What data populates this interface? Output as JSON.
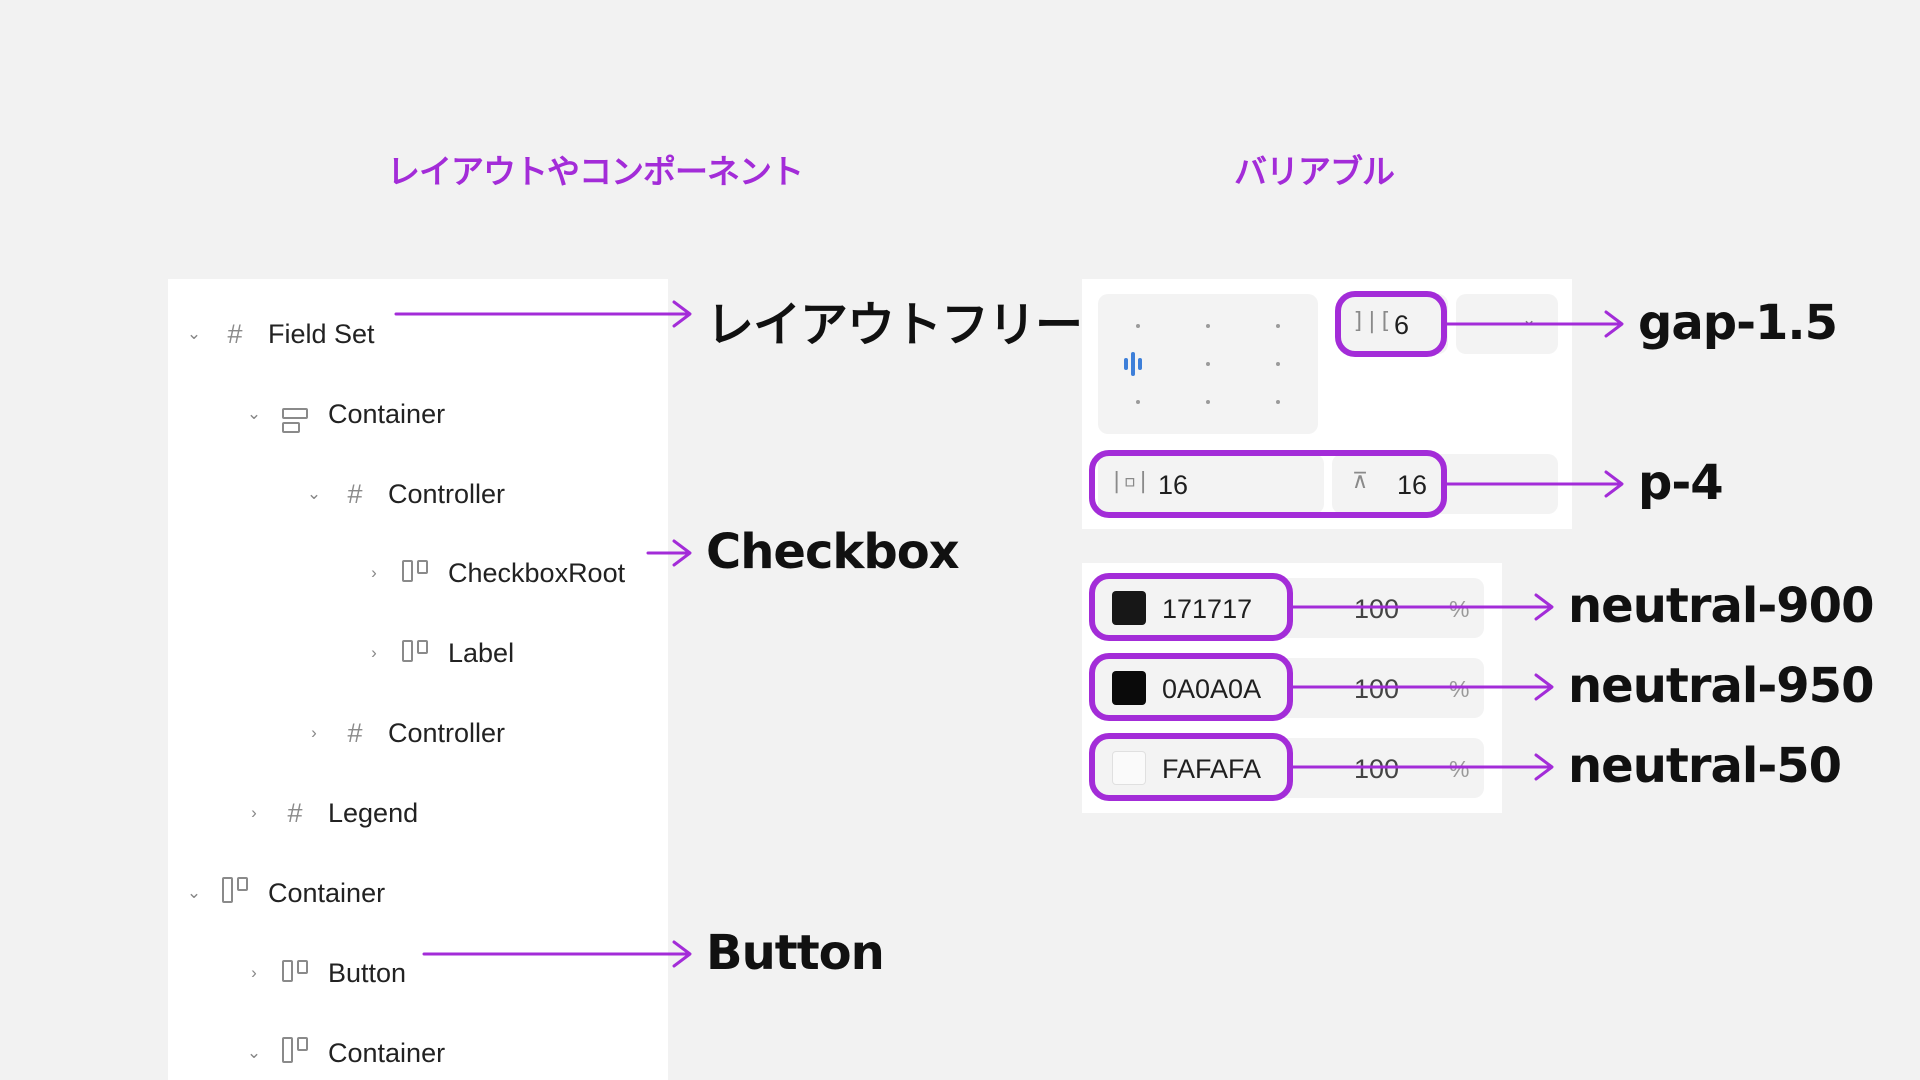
{
  "headings": {
    "left": "レイアウトやコンポーネント",
    "right": "バリアブル"
  },
  "layer_tree": [
    {
      "label": "Field Set",
      "expanded": true,
      "icon": "frame-icon"
    },
    {
      "label": "Container",
      "expanded": true,
      "icon": "stack-icon"
    },
    {
      "label": "Controller",
      "expanded": true,
      "icon": "frame-icon"
    },
    {
      "label": "CheckboxRoot",
      "expanded": false,
      "icon": "columns-icon"
    },
    {
      "label": "Label",
      "expanded": false,
      "icon": "columns-icon"
    },
    {
      "label": "Controller",
      "expanded": false,
      "icon": "frame-icon"
    },
    {
      "label": "Legend",
      "expanded": false,
      "icon": "frame-icon"
    },
    {
      "label": "Container",
      "expanded": true,
      "icon": "columns-icon"
    },
    {
      "label": "Button",
      "expanded": false,
      "icon": "columns-icon"
    },
    {
      "label": "Container",
      "expanded": true,
      "icon": "columns-icon"
    }
  ],
  "spacing": {
    "gap_value": "6",
    "padding_horizontal": "16",
    "padding_vertical": "16"
  },
  "colors": [
    {
      "hex": "171717",
      "opacity": "100",
      "unit": "%",
      "swatch": "#171717"
    },
    {
      "hex": "0A0A0A",
      "opacity": "100",
      "unit": "%",
      "swatch": "#0a0a0a"
    },
    {
      "hex": "FAFAFA",
      "opacity": "100",
      "unit": "%",
      "swatch": "#fafafa"
    }
  ],
  "annotations": {
    "layout_tree": "レイアウトフリー",
    "checkbox": "Checkbox",
    "button": "Button",
    "gap": "gap-1.5",
    "padding": "p-4",
    "neutral_900": "neutral-900",
    "neutral_950": "neutral-950",
    "neutral_50": "neutral-50"
  },
  "accent_color": "#a32cd8"
}
